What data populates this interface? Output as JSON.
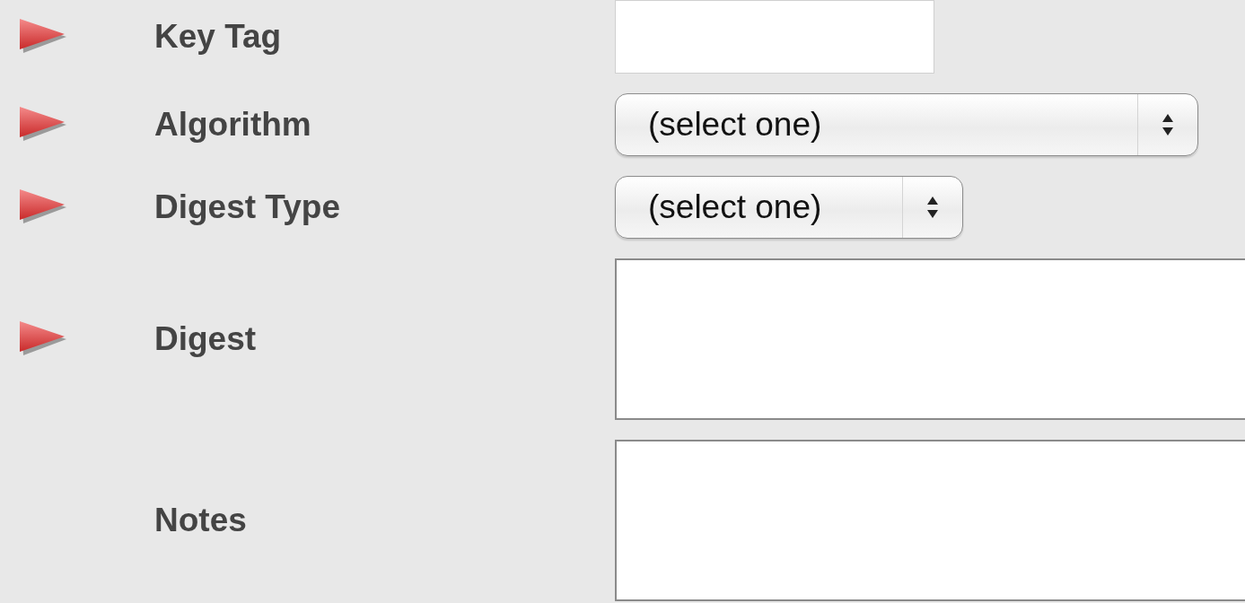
{
  "fields": [
    {
      "label": "Key Tag",
      "kind": "text",
      "required": true
    },
    {
      "label": "Algorithm",
      "kind": "longselect",
      "value": "(select one)",
      "required": true
    },
    {
      "label": "Digest Type",
      "kind": "select",
      "value": "(select one)",
      "required": true
    },
    {
      "label": "Digest",
      "kind": "textarea",
      "required": true
    },
    {
      "label": "Notes",
      "kind": "textarea",
      "required": false
    }
  ]
}
